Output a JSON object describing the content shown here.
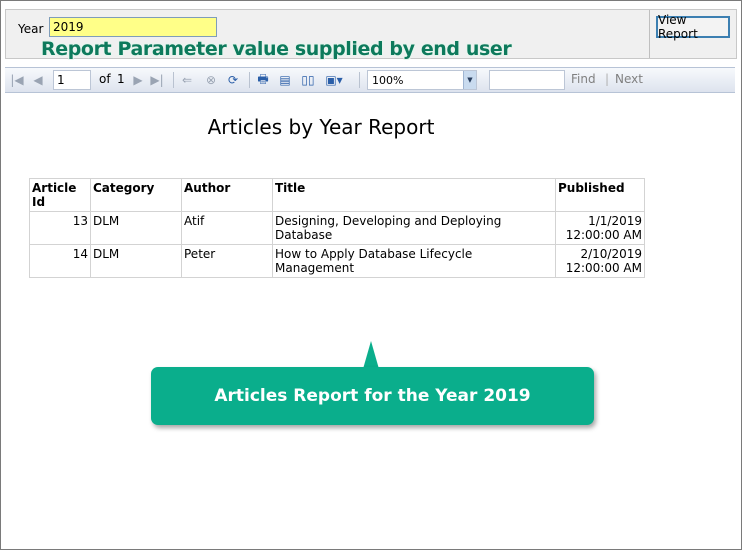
{
  "params": {
    "year_label": "Year",
    "year_value": "2019",
    "view_report_label": "View Report"
  },
  "annotation": {
    "overlay_text": "Report Parameter value supplied by end user",
    "callout_text": "Articles Report for the Year 2019"
  },
  "toolbar": {
    "first_page_icon": "first-page-icon",
    "prev_page_icon": "prev-page-icon",
    "page_value": "1",
    "of_label": "of",
    "total_pages": "1",
    "next_page_icon": "next-page-icon",
    "last_page_icon": "last-page-icon",
    "back_icon": "back-to-parent-icon",
    "stop_icon": "stop-icon",
    "refresh_icon": "refresh-icon",
    "print_icon": "print-icon",
    "print_layout_icon": "print-layout-icon",
    "page_setup_icon": "page-setup-icon",
    "export_icon": "export-icon",
    "zoom_value": "100%",
    "find_label": "Find",
    "find_separator": "|",
    "next_label": "Next"
  },
  "report": {
    "title": "Articles by Year Report",
    "columns": [
      "Article Id",
      "Category",
      "Author",
      "Title",
      "Published"
    ],
    "rows": [
      {
        "id": "13",
        "category": "DLM",
        "author": "Atif",
        "title": "Designing, Developing and Deploying Database",
        "published_date": "1/1/2019",
        "published_time": "12:00:00 AM"
      },
      {
        "id": "14",
        "category": "DLM",
        "author": "Peter",
        "title": "How to Apply Database Lifecycle Management",
        "published_date": "2/10/2019",
        "published_time": "12:00:00 AM"
      }
    ]
  }
}
